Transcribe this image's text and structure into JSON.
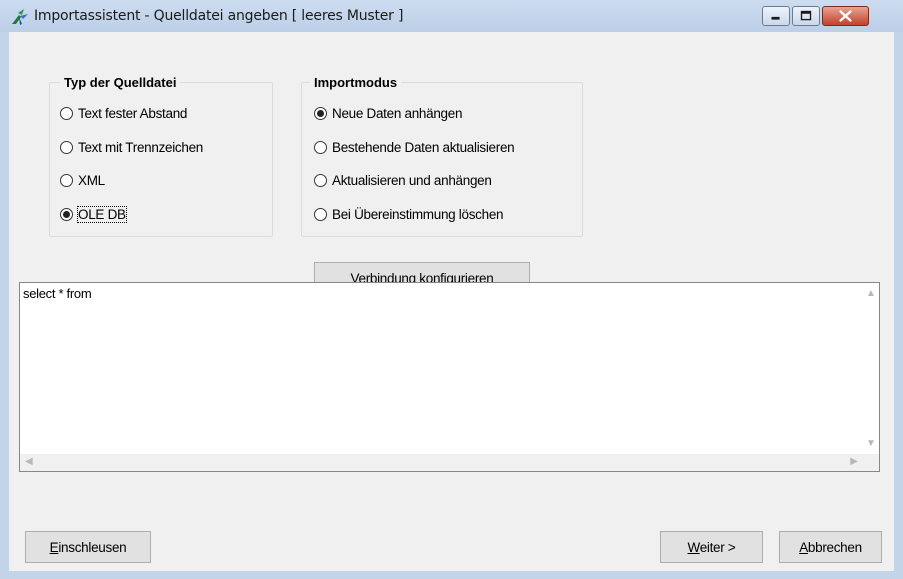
{
  "window": {
    "title": "Importassistent - Quelldatei angeben [ leeres Muster ]"
  },
  "titlebar_buttons": {
    "minimize_icon": "minimize-icon",
    "maximize_icon": "maximize-icon",
    "close_icon": "close-icon"
  },
  "source_type": {
    "legend": "Typ der Quelldatei",
    "options": [
      {
        "label": "Text fester Abstand",
        "checked": false
      },
      {
        "label": "Text mit Trennzeichen",
        "checked": false
      },
      {
        "label": "XML",
        "checked": false
      },
      {
        "label": "OLE DB",
        "checked": true
      }
    ]
  },
  "import_mode": {
    "legend": "Importmodus",
    "options": [
      {
        "label": "Neue Daten anhängen",
        "checked": true
      },
      {
        "label": "Bestehende Daten aktualisieren",
        "checked": false
      },
      {
        "label": "Aktualisieren und anhängen",
        "checked": false
      },
      {
        "label": "Bei Übereinstimmung löschen",
        "checked": false
      }
    ]
  },
  "configure_button": {
    "accel": "V",
    "rest": "erbindung konfigurieren"
  },
  "query": {
    "text": "select * from"
  },
  "footer": {
    "import_button": {
      "accel": "E",
      "rest": "inschleusen"
    },
    "next_button": {
      "accel": "W",
      "rest": "eiter >"
    },
    "cancel_button": {
      "accel": "A",
      "rest": "bbrechen"
    }
  },
  "colors": {
    "title_bar": "#c3d3e8",
    "client": "#f0f0f0",
    "close_button": "#c2412c"
  }
}
